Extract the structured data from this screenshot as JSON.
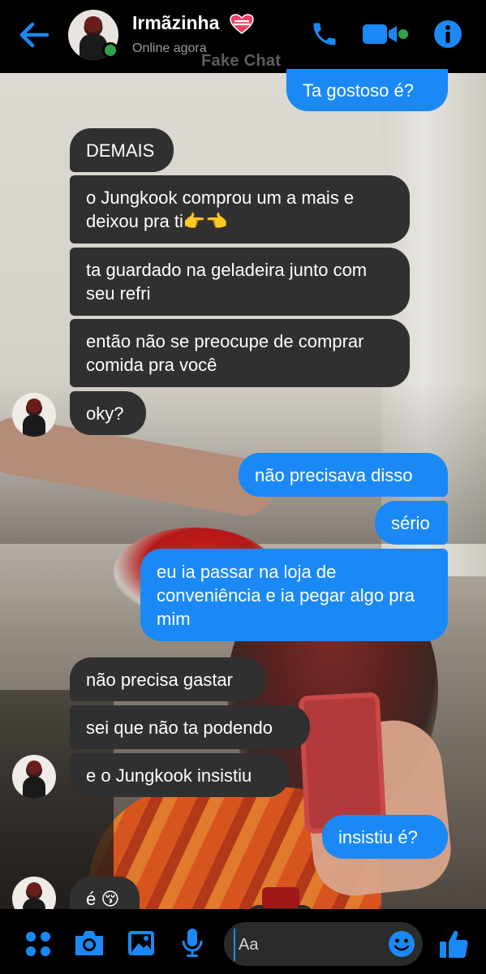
{
  "header": {
    "contact_name": "Irmãzinha",
    "status": "Online agora",
    "watermark": "Fake Chat"
  },
  "messages": [
    {
      "side": "sent",
      "text": "Ta gostoso é?"
    },
    {
      "side": "received",
      "text": "DEMAIS"
    },
    {
      "side": "received",
      "text": "o Jungkook comprou um a mais e deixou pra ti👉👈"
    },
    {
      "side": "received",
      "text": "ta guardado na geladeira junto com seu refri"
    },
    {
      "side": "received",
      "text": "então não se preocupe de comprar comida pra você"
    },
    {
      "side": "received",
      "text": "oky?"
    },
    {
      "side": "sent",
      "text": "não precisava disso"
    },
    {
      "side": "sent",
      "text": "sério"
    },
    {
      "side": "sent",
      "text": "eu ia passar na loja de conveniência e ia pegar algo pra mim"
    },
    {
      "side": "received",
      "text": "não precisa gastar"
    },
    {
      "side": "received",
      "text": "sei que não ta podendo"
    },
    {
      "side": "received",
      "text": "e o Jungkook insistiu"
    },
    {
      "side": "sent",
      "text": "insistiu é?"
    },
    {
      "side": "received",
      "text": "é 😚"
    }
  ],
  "composer": {
    "placeholder": "Aa"
  },
  "colors": {
    "accent": "#1b89f5",
    "received_bubble": "#303030",
    "online": "#31a24c"
  },
  "icons": {
    "header": [
      "back-arrow-icon",
      "heart-icon",
      "phone-icon",
      "video-camera-icon",
      "info-icon"
    ],
    "bottom": [
      "apps-grid-icon",
      "camera-icon",
      "image-icon",
      "microphone-icon",
      "emoji-icon",
      "thumbs-up-icon"
    ]
  }
}
